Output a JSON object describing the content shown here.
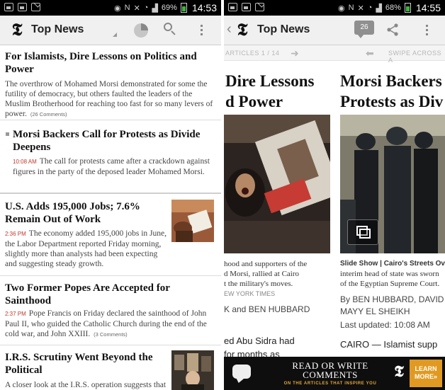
{
  "left_screen": {
    "status_bar": {
      "battery": "69%",
      "time": "14:53"
    },
    "action_bar": {
      "logo": "𝕿",
      "title": "Top News"
    },
    "stories": [
      {
        "headline": "For Islamists, Dire Lessons on Politics and Power",
        "summary": "The overthrow of Mohamed Morsi demonstrated for some the futility of democracy, but others faulted the leaders of the Muslim Brotherhood for reaching too fast for so many levers of power.",
        "comments": "(26 Comments)"
      },
      {
        "headline": "Morsi Backers Call for Protests as Divide Deepens",
        "time": "10:08 AM",
        "summary": "The call for protests came after a crackdown against figures in the party of the deposed leader Mohamed Morsi."
      },
      {
        "headline": "U.S. Adds 195,000 Jobs; 7.6% Remain Out of Work",
        "time": "2:36 PM",
        "summary": "The economy added 195,000 jobs in June, the Labor Department reported Friday morning, slightly more than analysts had been expecting and suggesting steady growth."
      },
      {
        "headline": "Two Former Popes Are Accepted for Sainthood",
        "time": "2:37 PM",
        "summary": "Pope Francis on Friday declared the sainthood of John Paul II, who guided the Catholic Church during the end of the cold war, and John XXIII.",
        "comments": "(3 Comments)"
      },
      {
        "headline": "I.R.S. Scrutiny Went Beyond the Political",
        "summary": "A closer look at the I.R.S. operation suggests that"
      }
    ]
  },
  "right_screen": {
    "status_bar": {
      "battery": "68%",
      "time": "14:55"
    },
    "action_bar": {
      "back": "‹",
      "logo": "𝕿",
      "title": "Top News",
      "comment_count": "26"
    },
    "nav_strip": {
      "articles": "ARTICLES  1  /  14",
      "swipe": "SWIPE ACROSS A"
    },
    "article_left": {
      "headline_line1": "Dire Lessons",
      "headline_line2": "d Power",
      "caption_line1": "hood and supporters of the",
      "caption_line2": "d Morsi, rallied at Cairo",
      "caption_line3": "t the military's moves.",
      "caption_credit": "EW YORK TIMES",
      "byline": "K and BEN HUBBARD",
      "body_line1": "ed Abu Sidra had",
      "body_line2": "for months as"
    },
    "article_right": {
      "headline_line1": "Morsi Backers",
      "headline_line2": "Protests as Div",
      "caption_title": "Slide Show | Cairo's Streets Ov",
      "caption_line1": "interim head of state was sworn",
      "caption_line2": "of the Egyptian Supreme Court.",
      "byline_line1": "By BEN HUBBARD, DAVID",
      "byline_line2": "MAYY EL SHEIKH",
      "updated": "Last updated: 10:08 AM",
      "body_line1": "CAIRO — Islamist supp"
    },
    "banner": {
      "main_line1": "READ OR WRITE",
      "main_line2": "COMMENTS",
      "sub": "ON THE ARTICLES THAT INSPIRE YOU",
      "logo": "𝕿",
      "learn_line1": "LEARN",
      "learn_line2": "MORE»"
    }
  },
  "colors": {
    "accent_red": "#c0392b",
    "banner_orange": "#e09a22",
    "battery_green": "#3db33d"
  }
}
